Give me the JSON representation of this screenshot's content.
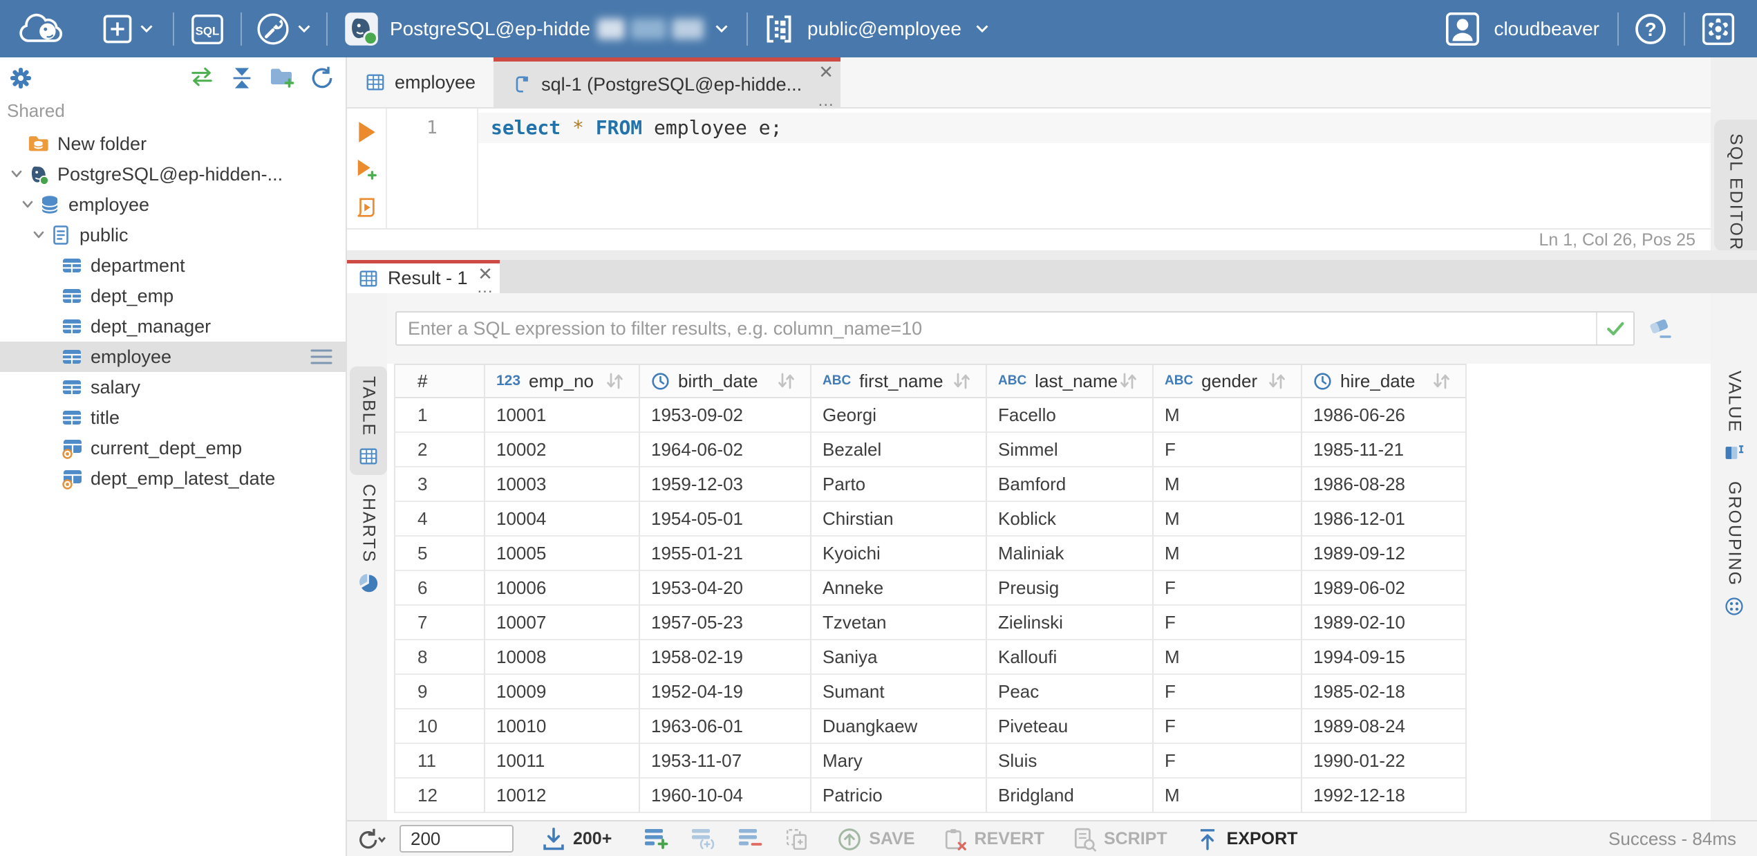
{
  "topbar": {
    "connection_label": "PostgreSQL@ep-hidde",
    "schema_label": "public@employee",
    "user_label": "cloudbeaver"
  },
  "sidebar": {
    "section_label": "Shared",
    "tree": [
      {
        "depth": 0,
        "icon": "folder-db",
        "label": "New folder"
      },
      {
        "depth": 0,
        "icon": "postgres",
        "label": "PostgreSQL@ep-hidden-...",
        "expanded": true
      },
      {
        "depth": 1,
        "icon": "database",
        "label": "employee",
        "expanded": true
      },
      {
        "depth": 2,
        "icon": "schema",
        "label": "public",
        "expanded": true
      },
      {
        "depth": 3,
        "icon": "table",
        "label": "department"
      },
      {
        "depth": 3,
        "icon": "table",
        "label": "dept_emp"
      },
      {
        "depth": 3,
        "icon": "table",
        "label": "dept_manager"
      },
      {
        "depth": 3,
        "icon": "table",
        "label": "employee",
        "selected": true,
        "menu": true
      },
      {
        "depth": 3,
        "icon": "table",
        "label": "salary"
      },
      {
        "depth": 3,
        "icon": "table",
        "label": "title"
      },
      {
        "depth": 3,
        "icon": "view",
        "label": "current_dept_emp"
      },
      {
        "depth": 3,
        "icon": "view",
        "label": "dept_emp_latest_date"
      }
    ]
  },
  "editor": {
    "tabs": [
      {
        "label": "employee",
        "icon": "grid-outline",
        "active": false
      },
      {
        "label": "sql-1 (PostgreSQL@ep-hidde...",
        "icon": "script",
        "active": true
      }
    ],
    "line_number": "1",
    "code_tokens": [
      {
        "text": "select",
        "type": "keyword"
      },
      {
        "text": " ",
        "type": "plain"
      },
      {
        "text": "*",
        "type": "star"
      },
      {
        "text": " ",
        "type": "plain"
      },
      {
        "text": "FROM",
        "type": "keyword"
      },
      {
        "text": " employee e;",
        "type": "plain"
      }
    ],
    "status": "Ln 1, Col 26, Pos 25",
    "panel_label": "SQL EDITOR"
  },
  "result": {
    "tab_label": "Result - 1",
    "filter_placeholder": "Enter a SQL expression to filter results, e.g. column_name=10",
    "left_tabs": [
      {
        "label": "TABLE",
        "icon": "grid-outline",
        "active": true
      },
      {
        "label": "CHARTS",
        "icon": "pie",
        "active": false
      }
    ],
    "right_tabs": [
      {
        "label": "VALUE",
        "icon": "value-panel"
      },
      {
        "label": "GROUPING",
        "icon": "grouping"
      }
    ],
    "grid": {
      "columns": [
        {
          "label": "#",
          "type": null
        },
        {
          "label": "emp_no",
          "type": "number"
        },
        {
          "label": "birth_date",
          "type": "datetime"
        },
        {
          "label": "first_name",
          "type": "string"
        },
        {
          "label": "last_name",
          "type": "string"
        },
        {
          "label": "gender",
          "type": "string"
        },
        {
          "label": "hire_date",
          "type": "datetime"
        }
      ],
      "rows": [
        [
          "1",
          "10001",
          "1953-09-02",
          "Georgi",
          "Facello",
          "M",
          "1986-06-26"
        ],
        [
          "2",
          "10002",
          "1964-06-02",
          "Bezalel",
          "Simmel",
          "F",
          "1985-11-21"
        ],
        [
          "3",
          "10003",
          "1959-12-03",
          "Parto",
          "Bamford",
          "M",
          "1986-08-28"
        ],
        [
          "4",
          "10004",
          "1954-05-01",
          "Chirstian",
          "Koblick",
          "M",
          "1986-12-01"
        ],
        [
          "5",
          "10005",
          "1955-01-21",
          "Kyoichi",
          "Maliniak",
          "M",
          "1989-09-12"
        ],
        [
          "6",
          "10006",
          "1953-04-20",
          "Anneke",
          "Preusig",
          "F",
          "1989-06-02"
        ],
        [
          "7",
          "10007",
          "1957-05-23",
          "Tzvetan",
          "Zielinski",
          "F",
          "1989-02-10"
        ],
        [
          "8",
          "10008",
          "1958-02-19",
          "Saniya",
          "Kalloufi",
          "M",
          "1994-09-15"
        ],
        [
          "9",
          "10009",
          "1952-04-19",
          "Sumant",
          "Peac",
          "F",
          "1985-02-18"
        ],
        [
          "10",
          "10010",
          "1963-06-01",
          "Duangkaew",
          "Piveteau",
          "F",
          "1989-08-24"
        ],
        [
          "11",
          "10011",
          "1953-11-07",
          "Mary",
          "Sluis",
          "F",
          "1990-01-22"
        ],
        [
          "12",
          "10012",
          "1960-10-04",
          "Patricio",
          "Bridgland",
          "M",
          "1992-12-18"
        ]
      ]
    },
    "toolbar": {
      "row_limit": "200",
      "fetch_more_label": "200+",
      "save_label": "SAVE",
      "revert_label": "REVERT",
      "script_label": "SCRIPT",
      "export_label": "EXPORT",
      "status": "Success - 84ms"
    }
  }
}
